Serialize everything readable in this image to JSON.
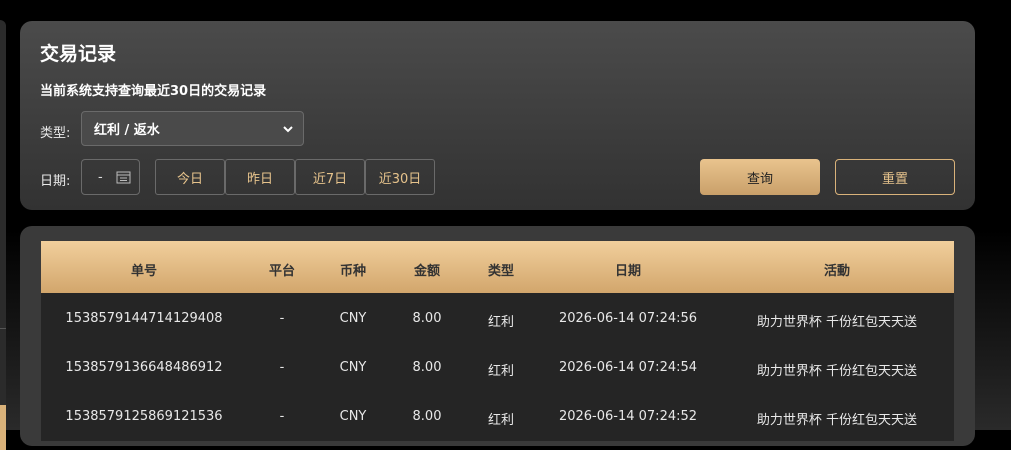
{
  "page": {
    "title": "交易记录",
    "subtitle": "当前系统支持查询最近30日的交易记录"
  },
  "filters": {
    "type_label": "类型:",
    "type_value": "红利 / 返水",
    "date_label": "日期:",
    "date_separator": "-",
    "quick_ranges": [
      "今日",
      "昨日",
      "近7日",
      "近30日"
    ],
    "query_label": "查询",
    "reset_label": "重置"
  },
  "table": {
    "columns": [
      "单号",
      "平台",
      "币种",
      "金额",
      "类型",
      "日期",
      "活動"
    ],
    "rows": [
      [
        "1538579144714129408",
        "-",
        "CNY",
        "8.00",
        "红利",
        "2026-06-14 07:24:56",
        "助力世界杯 千份红包天天送"
      ],
      [
        "1538579136648486912",
        "-",
        "CNY",
        "8.00",
        "红利",
        "2026-06-14 07:24:54",
        "助力世界杯 千份红包天天送"
      ],
      [
        "1538579125869121536",
        "-",
        "CNY",
        "8.00",
        "红利",
        "2026-06-14 07:24:52",
        "助力世界杯 千份红包天天送"
      ]
    ]
  },
  "colors": {
    "accent_gold": "#d9b27a",
    "panel_bg": "#3a3a3a",
    "header_gold": "#e9c48e"
  },
  "icons": {
    "select": "chevron-down-icon",
    "date": "calendar-icon"
  }
}
